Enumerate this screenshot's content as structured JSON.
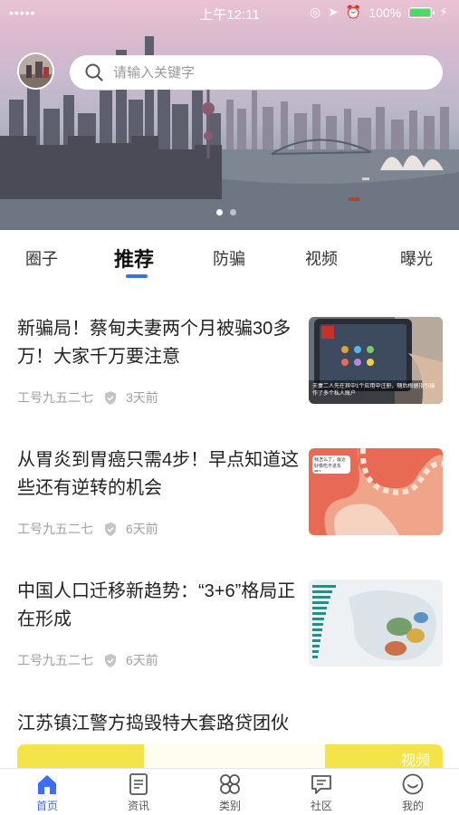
{
  "status_bar": {
    "carrier": "•••••",
    "time": "上午12:11",
    "battery": "100%"
  },
  "header": {
    "search": {
      "placeholder": "请输入关键字"
    }
  },
  "tabs": [
    {
      "label": "圈子"
    },
    {
      "label": "推荐"
    },
    {
      "label": "防骗"
    },
    {
      "label": "视频"
    },
    {
      "label": "曝光"
    }
  ],
  "active_tab": "推荐",
  "articles": [
    {
      "title": "新骗局！蔡甸夫妻两个月被骗30多万！大家千万要注意",
      "author": "工号九五二七",
      "time": "3天前"
    },
    {
      "title": "从胃炎到胃癌只需4步！早点知道这些还有逆转的机会",
      "author": "工号九五二七",
      "time": "6天前"
    },
    {
      "title": "中国人口迁移新趋势：“3+6”格局正在形成",
      "author": "工号九五二七",
      "time": "6天前"
    },
    {
      "title": "江苏镇江警方捣毁特大套路贷团伙"
    }
  ],
  "thumb_text": {
    "scam_caption": "夫妻二人先在其中1个应用中注册，随后根据指引操作了多个私人账户",
    "stomach_bubble": "我怎么了，最近好像吃不进东西？"
  },
  "partial_card_text": "视频",
  "bottom_nav": [
    {
      "label": "首页",
      "icon": "home-icon"
    },
    {
      "label": "资讯",
      "icon": "news-icon"
    },
    {
      "label": "类别",
      "icon": "category-icon"
    },
    {
      "label": "社区",
      "icon": "community-icon"
    },
    {
      "label": "我的",
      "icon": "profile-icon"
    }
  ],
  "colors": {
    "accent": "#3b6df5",
    "meta_text": "#a0a0a0",
    "battery": "#4cd964"
  }
}
